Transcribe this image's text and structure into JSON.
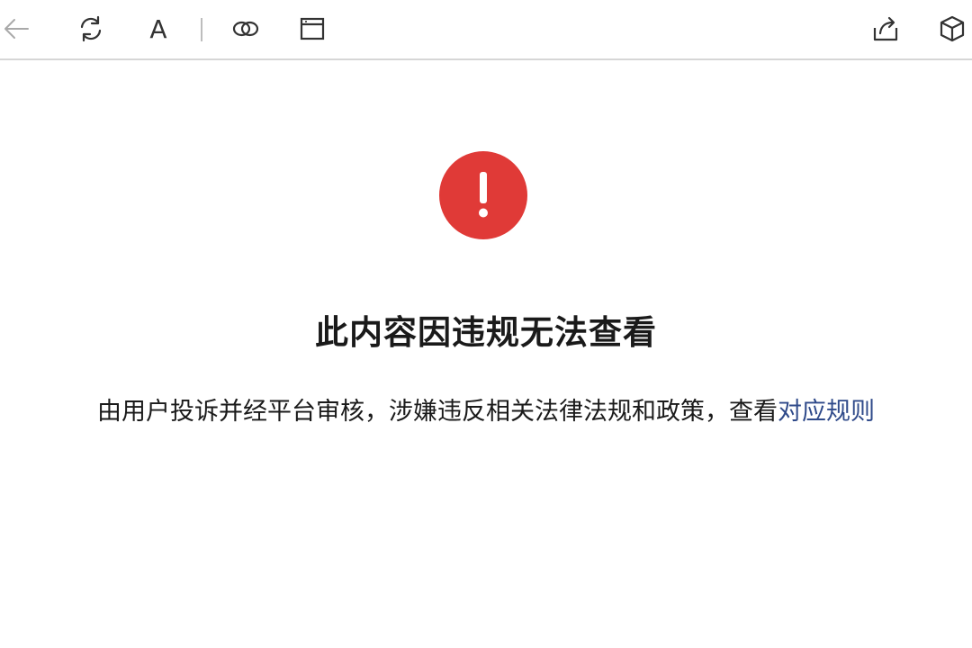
{
  "toolbar": {
    "font_button_label": "A",
    "icons": [
      "back-arrow-icon",
      "refresh-icon",
      "font-size-icon",
      "link-icon",
      "window-icon",
      "share-icon",
      "cube-icon"
    ]
  },
  "notice": {
    "icon": "exclamation-circle-icon",
    "icon_color": "#e03a37",
    "title": "此内容因违规无法查看",
    "description": "由用户投诉并经平台审核，涉嫌违反相关法律法规和政策，查看",
    "rules_link": "对应规则",
    "link_color": "#2f4a8a"
  }
}
